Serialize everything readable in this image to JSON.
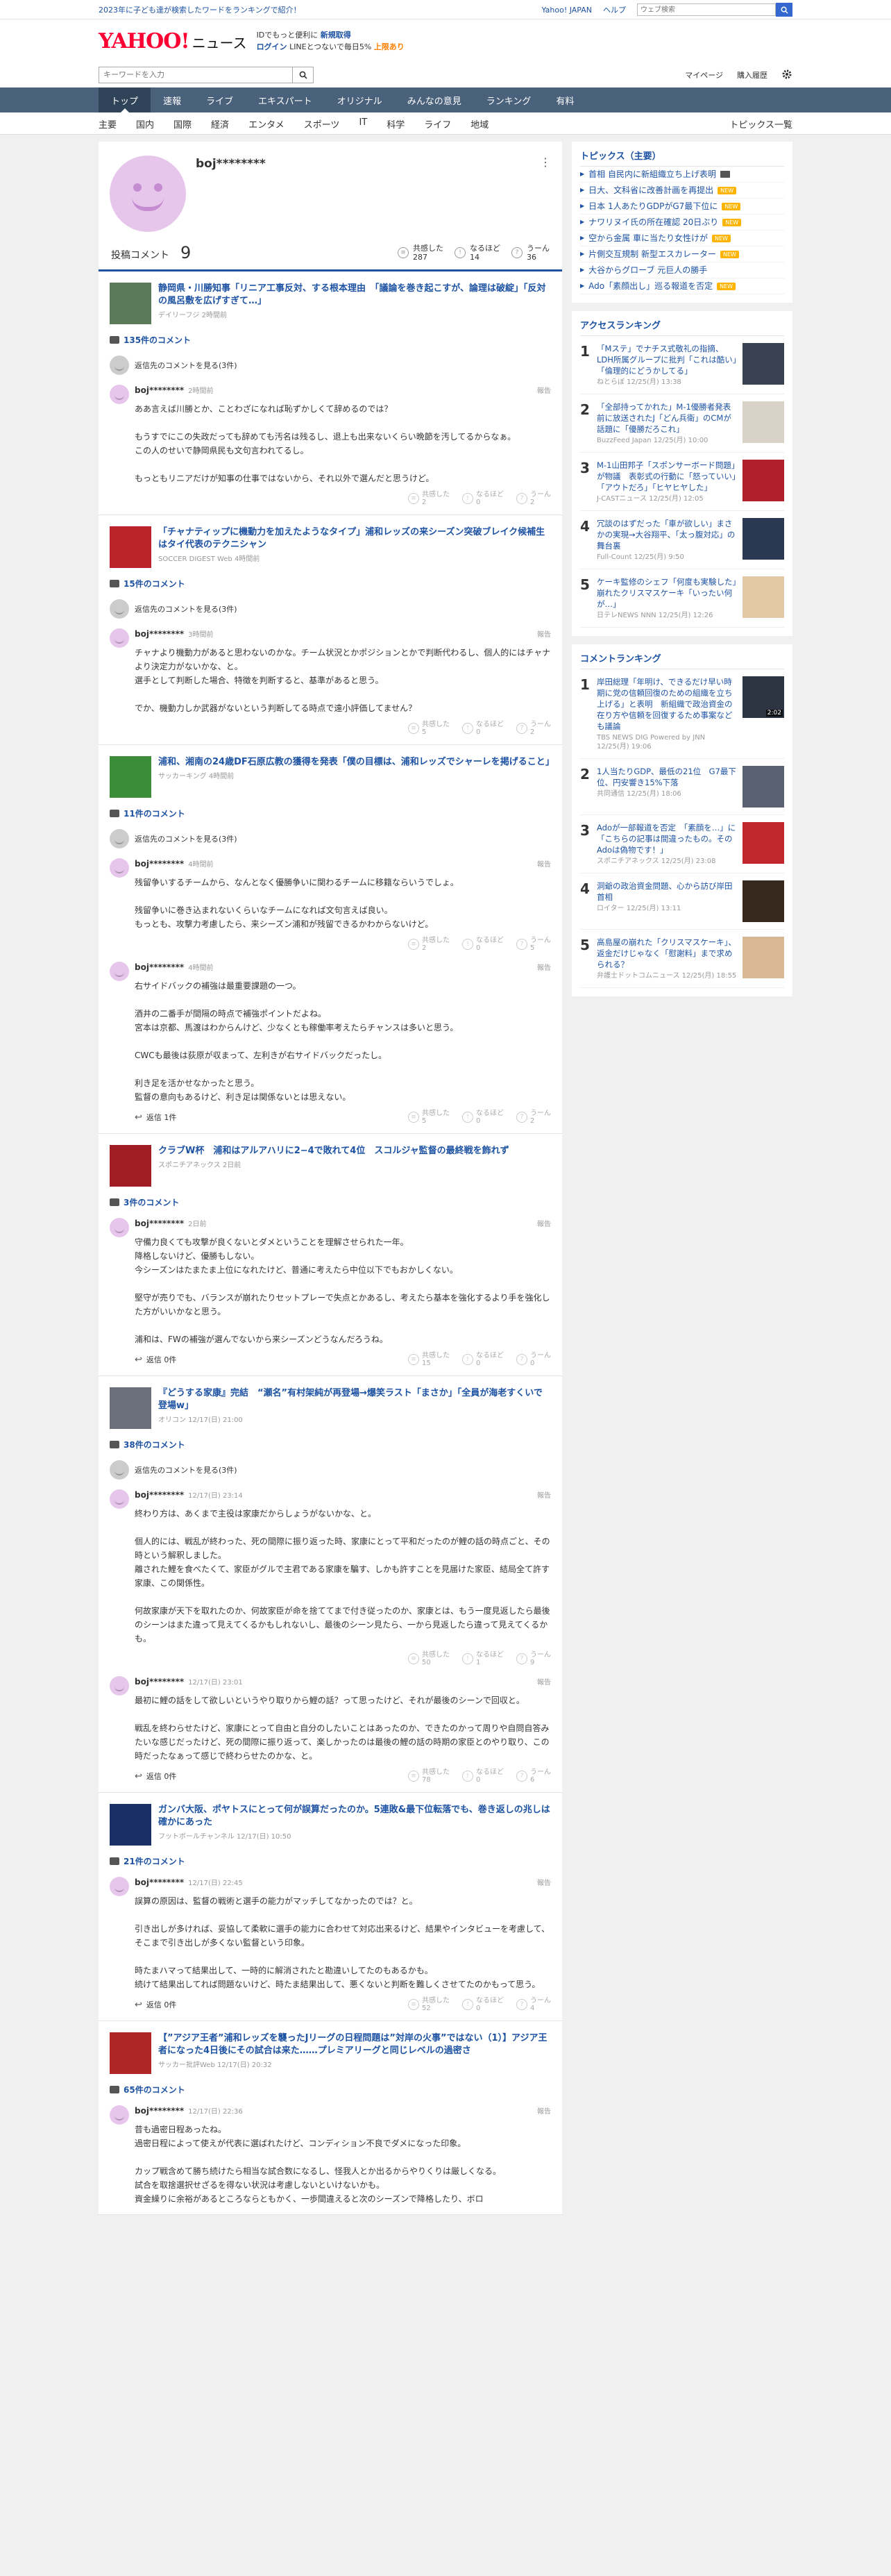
{
  "topbar": {
    "promo": "2023年に子ども達が検索したワードをランキングで紹介！",
    "links": [
      "Yahoo! JAPAN",
      "ヘルプ"
    ],
    "search_placeholder": "ウェブ検索"
  },
  "header": {
    "logo_main": "YAHOO!",
    "logo_sub": "JAPAN",
    "logo_news": "ニュース",
    "promo_line1_a": "IDでもっと便利に",
    "promo_line1_b": "新規取得",
    "promo_line2_login": "ログイン",
    "promo_line2_text": "LINEとつないで毎日5%",
    "promo_line2_pt": "上限あり"
  },
  "subheader": {
    "keyword_placeholder": "キーワードを入力",
    "mypage": "マイページ",
    "history": "購入履歴"
  },
  "nav": [
    "トップ",
    "速報",
    "ライブ",
    "エキスパート",
    "オリジナル",
    "みんなの意見",
    "ランキング",
    "有料"
  ],
  "subnav": [
    "主要",
    "国内",
    "国際",
    "経済",
    "エンタメ",
    "スポーツ",
    "IT",
    "科学",
    "ライフ",
    "地域"
  ],
  "subnav_right": "トピックス一覧",
  "profile": {
    "name": "boj********",
    "posted_label": "投稿コメント",
    "posted_count": "9",
    "stats": [
      {
        "icon": "≡",
        "label": "共感した",
        "value": "287"
      },
      {
        "icon": "○",
        "label": "なるほど",
        "value": "14"
      },
      {
        "icon": "～",
        "label": "うーん",
        "value": "36"
      }
    ]
  },
  "labels": {
    "show_replies": "返信先のコメントを見る(3件)",
    "report": "報告",
    "replies_zero": "返信 0件",
    "replies_one": "返信 1件",
    "agree": "共感した",
    "naruhodo": "なるほど",
    "hmm": "うーん"
  },
  "articles": [
    {
      "title": "静岡県・川勝知事「リニア工事反対、する根本理由　「議論を巻き起こすが、論理は破綻」「反対の風呂敷を広げすぎて…」",
      "source": "デイリーフジ 2時間前",
      "count": "135件のコメント",
      "thumb": "#5b7a5a",
      "comments": [
        {
          "user": "boj********",
          "time": "2時間前",
          "text": "ああ言えば川勝とか、ことわざになれば恥ずかしくて辞めるのでは？\n\nもうすでにこの失政だっても辞めても汚名は残るし、退上も出来ないくらい晩節を汚してるからなぁ。\nこの人のせいで静岡県民も文句言われてるし。\n\nもっともリニアだけが知事の仕事ではないから、それ以外で選んだと思うけど。",
          "agree": "2",
          "naruhodo": "0",
          "hmm": "2",
          "reply": ""
        }
      ]
    },
    {
      "title": "「チャナティップに機動力を加えたようなタイプ」浦和レッズの来シーズン突破ブレイク候補生はタイ代表のテクニシャン",
      "source": "SOCCER DIGEST Web 4時間前",
      "count": "15件のコメント",
      "thumb": "#b9242a",
      "comments": [
        {
          "user": "boj********",
          "time": "3時間前",
          "text": "チャナより機動力があると思わないのかな。チーム状況とかポジションとかで判断代わるし、個人的にはチャナより決定力がないかな、と。\n選手として判断した場合、特徴を判断すると、基準があると思う。\n\nでか、機動力しか武器がないという判断してる時点で遠小評価してません？",
          "agree": "5",
          "naruhodo": "0",
          "hmm": "2",
          "reply": ""
        }
      ]
    },
    {
      "title": "浦和、湘南の24歳DF石原広教の獲得を発表「僕の目標は、浦和レッズでシャーレを掲げること」",
      "source": "サッカーキング 4時間前",
      "count": "11件のコメント",
      "thumb": "#3c8d3a",
      "comments": [
        {
          "user": "boj********",
          "time": "4時間前",
          "text": "残留争いするチームから、なんとなく優勝争いに関わるチームに移籍ならいうでしょ。\n\n残留争いに巻き込まれないくらいなチームになれば文句言えば良い。\nもっとも、攻撃力考慮したら、来シーズン浦和が残留できるかわからないけど。",
          "agree": "2",
          "naruhodo": "0",
          "hmm": "5",
          "reply": ""
        },
        {
          "user": "boj********",
          "time": "4時間前",
          "text": "右サイドバックの補強は最重要課題の一つ。\n\n酒井の二番手が間隔の時点で補強ポイントだよね。\n宮本は京都、馬渡はわからんけど、少なくとも稼働率考えたらチャンスは多いと思う。\n\nCWCも最後は荻原が収まって、左利きが右サイドバックだったし。\n\n利き足を活かせなかったと思う。\n監督の意向もあるけど、利き足は関係ないとは思えない。",
          "agree": "5",
          "naruhodo": "0",
          "hmm": "2",
          "reply": "one"
        }
      ]
    },
    {
      "title": "クラブW杯　浦和はアルアハリに2−4で敗れて4位　スコルジャ監督の最終戦を飾れず",
      "source": "スポニチアネックス 2日前",
      "count": "3件のコメント",
      "thumb": "#a01e23",
      "comments": [
        {
          "user": "boj********",
          "time": "2日前",
          "text": "守備力良くても攻撃が良くないとダメということを理解させられた一年。\n降格しないけど、優勝もしない。\n今シーズンはたまたま上位になれたけど、普通に考えたら中位以下でもおかしくない。\n\n堅守が売りでも、バランスが崩れたりセットプレーで失点とかあるし、考えたら基本を強化するより手を強化した方がいいかなと思う。\n\n浦和は、FWの補強が選んでないから来シーズンどうなんだろうね。",
          "agree": "15",
          "naruhodo": "0",
          "hmm": "0",
          "reply": "zero"
        }
      ]
    },
    {
      "title": "『どうする家康』完結　“瀬名”有村架純が再登場→爆笑ラスト「まさか」「全員が海老すくいで登場w」",
      "source": "オリコン 12/17(日) 21:00",
      "count": "38件のコメント",
      "thumb": "#6a6f7a",
      "comments": [
        {
          "user": "boj********",
          "time": "12/17(日) 23:14",
          "text": "終わり方は、あくまで主役は家康だからしょうがないかな、と。\n\n個人的には、戦乱が終わった、死の間際に振り返った時、家康にとって平和だったのが鯉の話の時点ごと、その時という解釈しました。\n離された鯉を食べたくて、家臣がグルで主君である家康を騙す、しかも許すことを見届けた家臣、結局全て許す家康、この関係性。\n\n何故家康が天下を取れたのか、何故家臣が命を捨ててまで付き従ったのか、家康とは、もう一度見返したら最後のシーンはまた違って見えてくるかもしれないし、最後のシーン見たら、一から見返したら違って見えてくるかも。",
          "agree": "50",
          "naruhodo": "1",
          "hmm": "9",
          "reply": ""
        },
        {
          "user": "boj********",
          "time": "12/17(日) 23:01",
          "text": "最初に鯉の話をして欲しいというやり取りから鯉の話？って思ったけど、それが最後のシーンで回収と。\n\n戦乱を終わらせたけど、家康にとって自由と自分のしたいことはあったのか、できたのかって周りや自問自答みたいな感じだったけど、死の間際に振り返って、楽しかったのは最後の鯉の話の時期の家臣とのやり取り、この時だったなぁって感じで終わらせたのかな、と。",
          "agree": "78",
          "naruhodo": "0",
          "hmm": "6",
          "reply": "zero"
        }
      ]
    },
    {
      "title": "ガンバ大阪、ポヤトスにとって何が誤算だったのか。5連敗&最下位転落でも、巻き返しの兆しは確かにあった",
      "source": "フットボールチャンネル 12/17(日) 10:50",
      "count": "21件のコメント",
      "thumb": "#1a2f66",
      "comments": [
        {
          "user": "boj********",
          "time": "12/17(日) 22:45",
          "text": "誤算の原因は、監督の戦術と選手の能力がマッチしてなかったのでは？と。\n\n引き出しが多ければ、妥協して柔軟に選手の能力に合わせて対応出来るけど、結果やインタビューを考慮して、そこまで引き出しが多くない監督という印象。\n\n時たまハマって結果出して、一時的に解消されたと勘違いしてたのもあるかも。\n続けて結果出してれば問題ないけど、時たま結果出して、悪くないと判断を難しくさせてたのかもって思う。",
          "agree": "52",
          "naruhodo": "0",
          "hmm": "4",
          "reply": "zero"
        }
      ]
    },
    {
      "title": "【”アジア王者”浦和レッズを襲ったJリーグの日程問題は”対岸の火事”ではない（1）】アジア王者になった4日後にその試合は来た……プレミアリーグと同じレベルの過密さ",
      "source": "サッカー批評Web 12/17(日) 20:32",
      "count": "65件のコメント",
      "thumb": "#b02626",
      "comments": [
        {
          "user": "boj********",
          "time": "12/17(日) 22:36",
          "text": "昔も過密日程あったね。\n過密日程によって使えが代表に選ばれたけど、コンディション不良でダメになった印象。\n\nカップ戦含めて勝ち続けたら相当な試合数になるし、怪我人とか出るからやりくりは厳しくなる。\n試合を取捨選択せざるを得ない状況は考慮しないといけないかも。\n資金繰りに余裕があるところならともかく、一歩間違えると次のシーズンで降格したり、ボロ",
          "agree": "",
          "naruhodo": "",
          "hmm": "",
          "reply": ""
        }
      ]
    }
  ],
  "sidebar": {
    "topics_title": "トピックス（主要）",
    "topics": [
      {
        "t": "首相 自民内に新組織立ち上げ表明",
        "tag": "img"
      },
      {
        "t": "日大、文科省に改善計画を再提出",
        "tag": "new"
      },
      {
        "t": "日本 1人あたりGDPがG7最下位に",
        "tag": "new"
      },
      {
        "t": "ナワリヌイ氏の所在確認 20日ぶり",
        "tag": "new"
      },
      {
        "t": "空から金属 車に当たり女性けが",
        "tag": "new"
      },
      {
        "t": "片側交互規制 新型エスカレーター",
        "tag": "new"
      },
      {
        "t": "大谷からグローブ 元巨人の勝手",
        "tag": ""
      },
      {
        "t": "Ado「素顔出し」巡る報道を否定",
        "tag": "new"
      }
    ],
    "new_label": "NEW",
    "access_title": "アクセスランキング",
    "access": [
      {
        "n": "1",
        "t": "「Mステ」でナチス式敬礼の指摘、LDH所属グループに批判「これは酷い」「倫理的にどうかしてる」",
        "s": "ねとらぼ 12/25(月) 13:38",
        "c": "#3a4150"
      },
      {
        "n": "2",
        "t": "「全部持ってかれた」M-1優勝者発表前に放送されたJ「どん兵衛」のCMが話題に「優勝だろこれ」",
        "s": "BuzzFeed Japan 12/25(月) 10:00",
        "c": "#d9d3c7"
      },
      {
        "n": "3",
        "t": "M-1山田邦子「スポンサーボード問題」が物議　表彰式の行動に「怒っていい」「アウトだろ」「ヒヤヒヤした」",
        "s": "J-CASTニュース 12/25(月) 12:05",
        "c": "#b01e2b"
      },
      {
        "n": "4",
        "t": "冗談のはずだった「車が欲しい」まさかの実現→大谷翔平、「太っ腹対応」の舞台裏",
        "s": "Full-Count 12/25(月) 9:50",
        "c": "#2b3852"
      },
      {
        "n": "5",
        "t": "ケーキ監修のシェフ「何度も実験した」　崩れたクリスマスケーキ「いったい何が…」",
        "s": "日テレNEWS NNN 12/25(月) 12:26",
        "c": "#e3c9a6"
      }
    ],
    "comment_title": "コメントランキング",
    "comments": [
      {
        "n": "1",
        "t": "岸田総理「年明け、できるだけ早い時期に党の信頼回復のための組織を立ち上げる」と表明　新組織で政治資金の在り方や信頼を回復するため事案なども議論",
        "s": "TBS NEWS DIG Powered by JNN 12/25(月) 19:06",
        "c": "#2e3542",
        "v": "2:02"
      },
      {
        "n": "2",
        "t": "1人当たりGDP、最低の21位　G7最下位、円安響き15%下落",
        "s": "共同通信 12/25(月) 18:06",
        "c": "#5a6170",
        "v": ""
      },
      {
        "n": "3",
        "t": "Adoが一部報道を否定　「素顔を…」に「こちらの記事は間違ったもの。そのAdoは偽物です！」",
        "s": "スポニチアネックス 12/25(月) 23:08",
        "c": "#c2272d",
        "v": ""
      },
      {
        "n": "4",
        "t": "洞爺の政治資金問題、心から訪び岸田首相",
        "s": "ロイター 12/25(月) 13:11",
        "c": "#38291f",
        "v": ""
      },
      {
        "n": "5",
        "t": "高島屋の崩れた「クリスマスケーキ」、返金だけじゃなく「慰謝料」まで求められる？",
        "s": "弁護士ドットコムニュース 12/25(月) 18:55",
        "c": "#d8b894",
        "v": ""
      }
    ]
  }
}
